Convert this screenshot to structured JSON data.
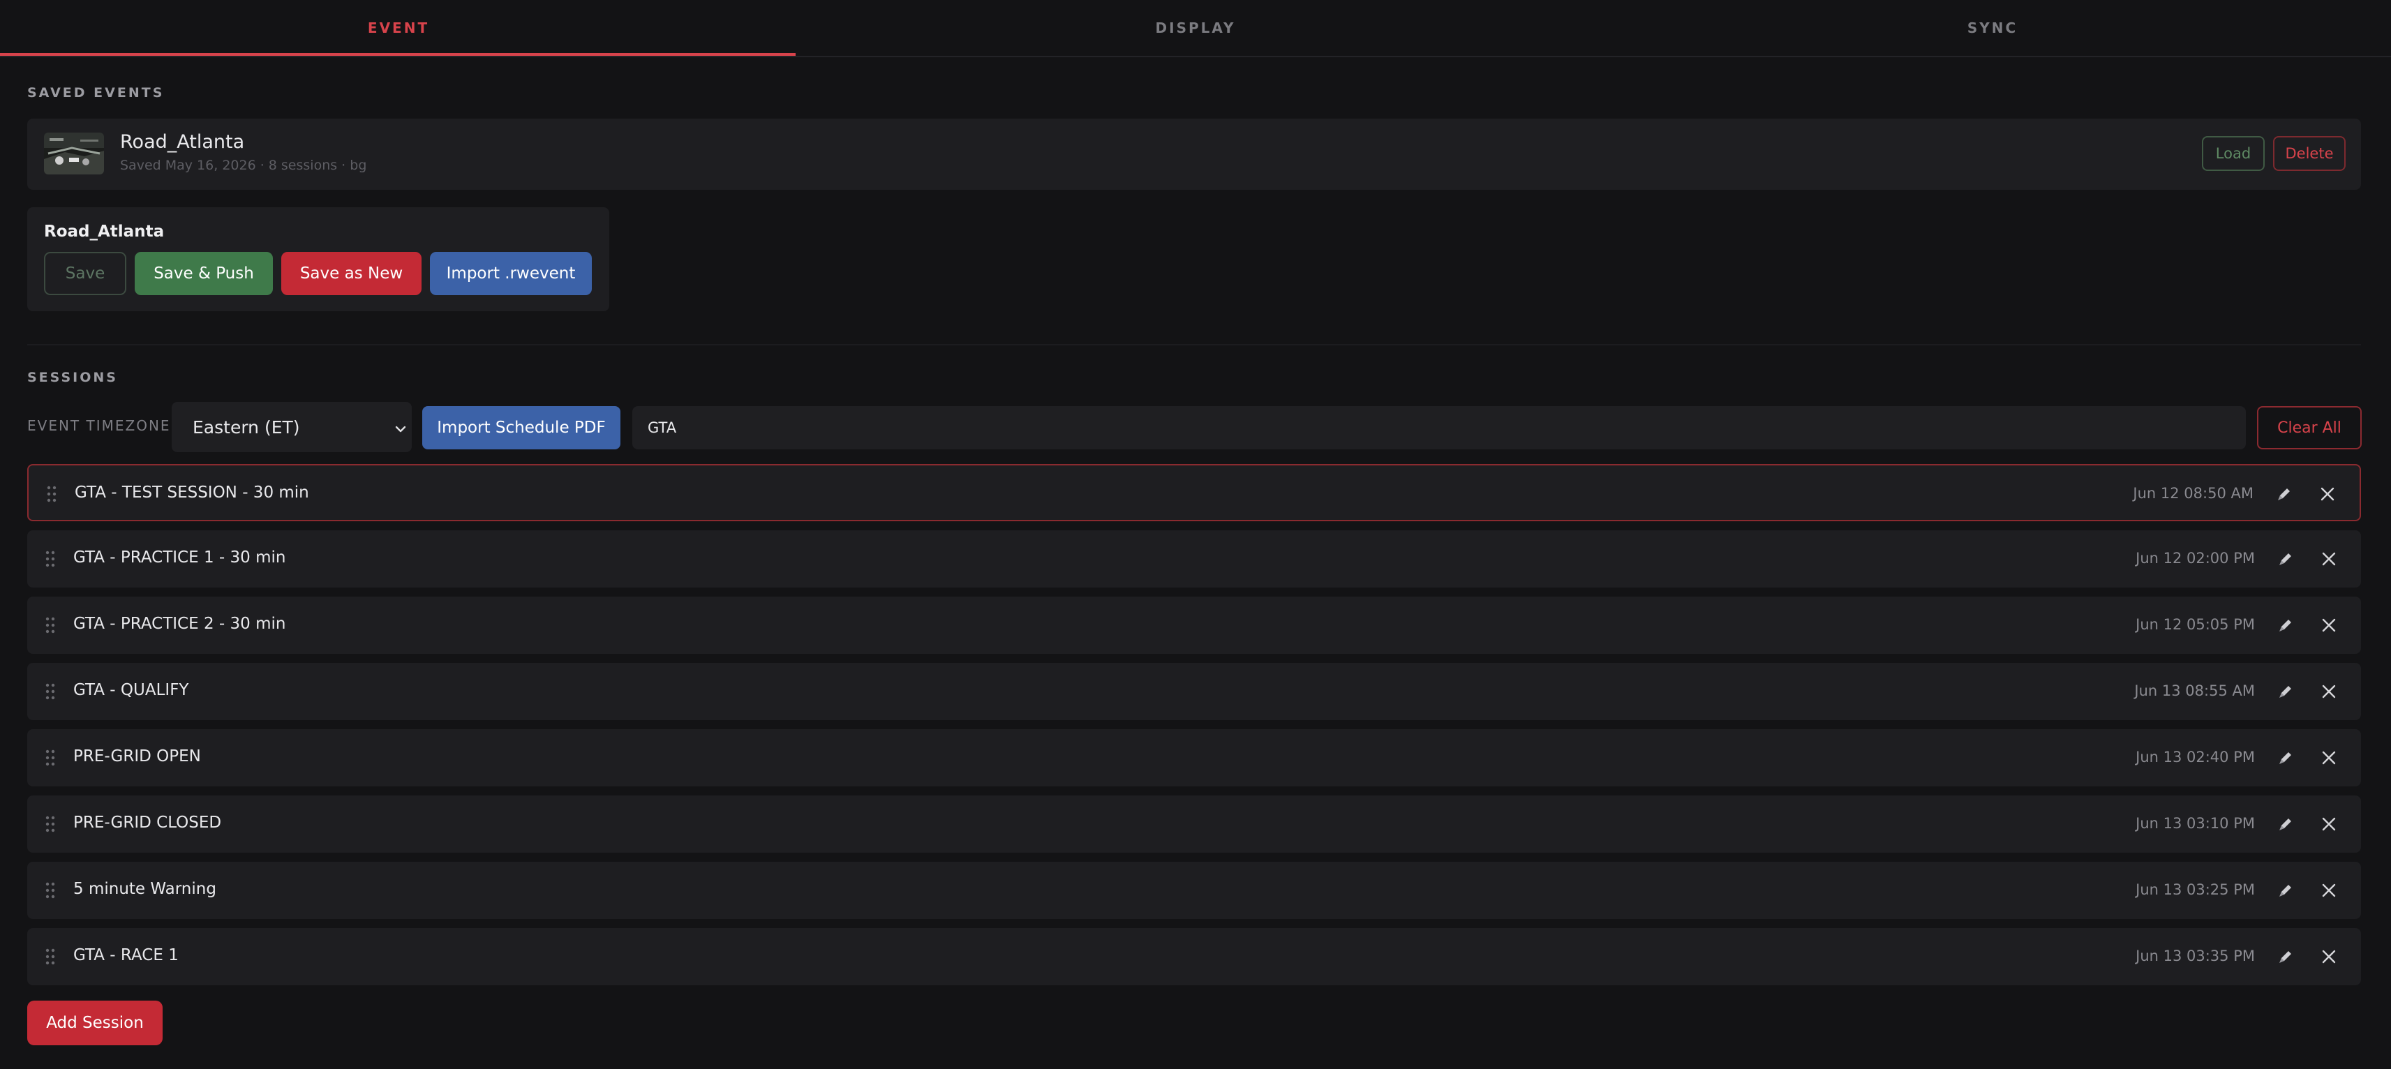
{
  "tabs": [
    {
      "label": "EVENT",
      "active": true
    },
    {
      "label": "DISPLAY",
      "active": false
    },
    {
      "label": "SYNC",
      "active": false
    }
  ],
  "saved_events": {
    "title": "SAVED EVENTS",
    "items": [
      {
        "name": "Road_Atlanta",
        "meta": "Saved May 16, 2026 · 8 sessions · bg",
        "load_label": "Load",
        "delete_label": "Delete"
      }
    ]
  },
  "current_event": {
    "name": "Road_Atlanta",
    "save_label": "Save",
    "save_push_label": "Save & Push",
    "save_as_new_label": "Save as New",
    "import_label": "Import .rwevent"
  },
  "sessions": {
    "title": "SESSIONS",
    "timezone_label": "EVENT TIMEZONE",
    "timezone_value": "Eastern (ET)",
    "import_pdf_label": "Import Schedule PDF",
    "filter_value": "GTA",
    "clear_all_label": "Clear All",
    "add_label": "Add Session",
    "items": [
      {
        "name": "GTA - TEST SESSION - 30 min",
        "time": "Jun 12 08:50 AM",
        "active": true
      },
      {
        "name": "GTA - PRACTICE 1 - 30 min",
        "time": "Jun 12 02:00 PM",
        "active": false
      },
      {
        "name": "GTA - PRACTICE 2 - 30 min",
        "time": "Jun 12 05:05 PM",
        "active": false
      },
      {
        "name": "GTA - QUALIFY",
        "time": "Jun 13 08:55 AM",
        "active": false
      },
      {
        "name": "PRE-GRID OPEN",
        "time": "Jun 13 02:40 PM",
        "active": false
      },
      {
        "name": "PRE-GRID CLOSED",
        "time": "Jun 13 03:10 PM",
        "active": false
      },
      {
        "name": "5 minute Warning",
        "time": "Jun 13 03:25 PM",
        "active": false
      },
      {
        "name": "GTA - RACE 1",
        "time": "Jun 13 03:35 PM",
        "active": false
      }
    ]
  },
  "colors": {
    "accent": "#d7434b",
    "background": "#131315",
    "card": "#1e1e21",
    "green": "#3f7a4a",
    "blue": "#3c62a8"
  },
  "icons": {
    "drag": "drag-handle-icon",
    "edit": "pencil-icon",
    "remove": "close-icon",
    "chevron": "chevron-down-icon"
  }
}
